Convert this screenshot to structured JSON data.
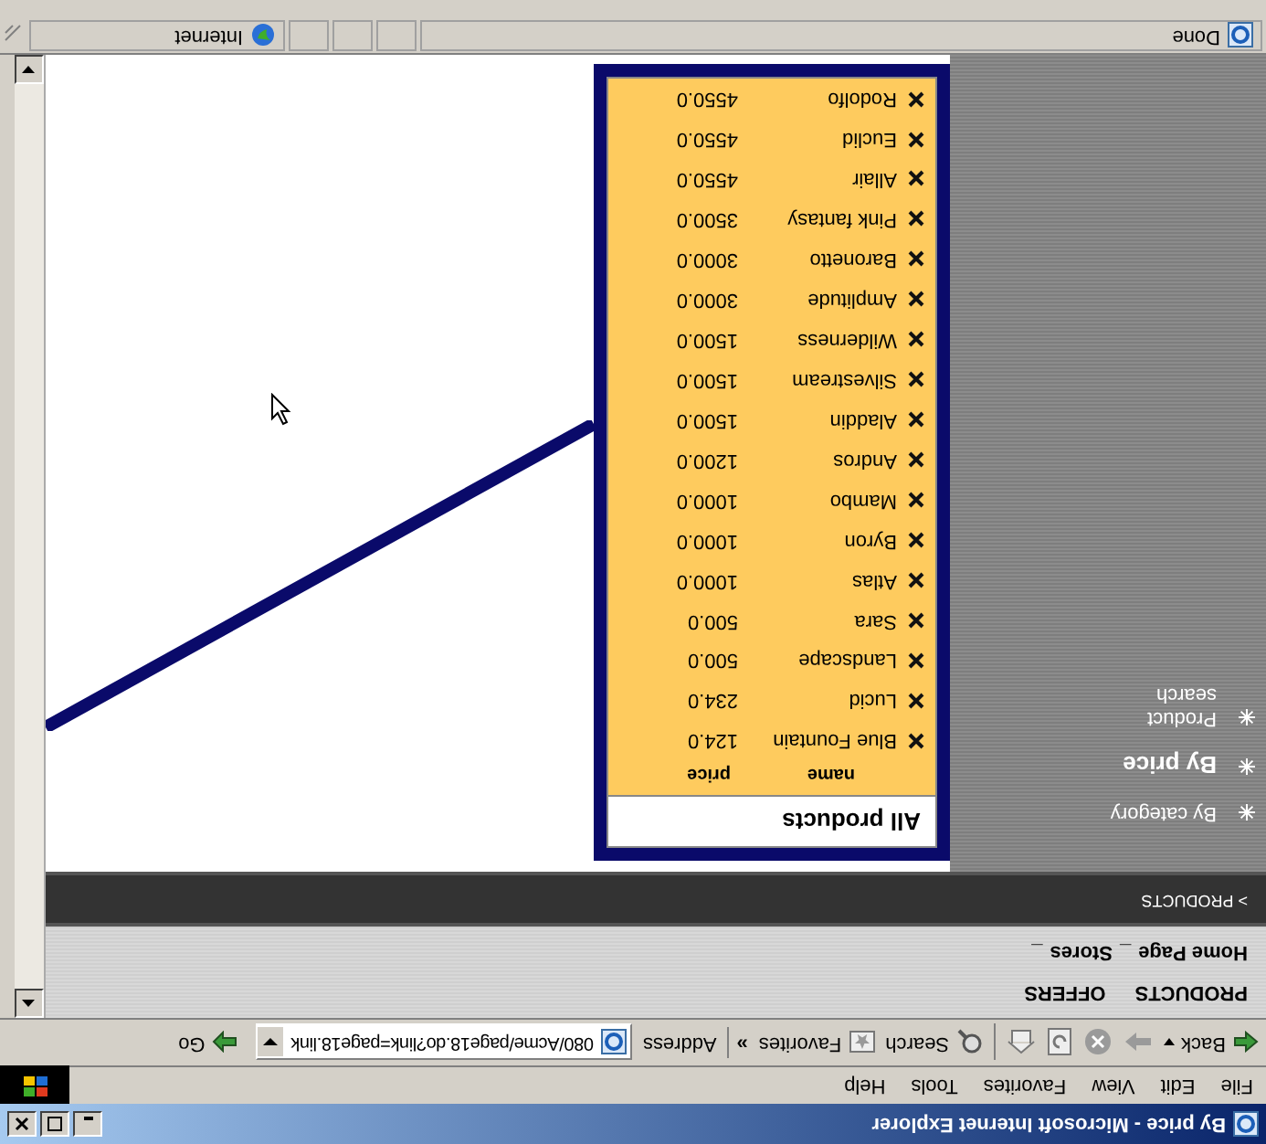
{
  "window": {
    "title": "By price - Microsoft Internet Explorer"
  },
  "menu": [
    "File",
    "Edit",
    "View",
    "Favorites",
    "Tools",
    "Help"
  ],
  "toolbar": {
    "back": "Back",
    "search": "Search",
    "favorites": "Favorites",
    "more": "»",
    "address_label": "Address",
    "address": "080/Acme/page18.do?link=page18.link",
    "go": "Go"
  },
  "nav": {
    "top_links": [
      "PRODUCTS",
      "OFFERS"
    ],
    "sub_links": [
      "Home Page",
      "_",
      "Stores",
      "_"
    ],
    "breadcrumb": "> PRODUCTS"
  },
  "sidebar": [
    {
      "label": "By category",
      "selected": false
    },
    {
      "label": "By price",
      "selected": true
    },
    {
      "label": "Product search",
      "selected": false
    }
  ],
  "panel": {
    "title": "All products",
    "columns": [
      "name",
      "price"
    ],
    "rows": [
      {
        "name": "Blue Fountain",
        "price": "124.0"
      },
      {
        "name": "Lucid",
        "price": "234.0"
      },
      {
        "name": "Landscape",
        "price": "500.0"
      },
      {
        "name": "Sara",
        "price": "500.0"
      },
      {
        "name": "Atlas",
        "price": "1000.0"
      },
      {
        "name": "Byron",
        "price": "1000.0"
      },
      {
        "name": "Mambo",
        "price": "1000.0"
      },
      {
        "name": "Andros",
        "price": "1200.0"
      },
      {
        "name": "Aladdin",
        "price": "1500.0"
      },
      {
        "name": "Silvestream",
        "price": "1500.0"
      },
      {
        "name": "Wilderness",
        "price": "1500.0"
      },
      {
        "name": "Amplitude",
        "price": "3000.0"
      },
      {
        "name": "Baronetto",
        "price": "3000.0"
      },
      {
        "name": "Pink fantasy",
        "price": "3500.0"
      },
      {
        "name": "Allair",
        "price": "4550.0"
      },
      {
        "name": "Euclid",
        "price": "4550.0"
      },
      {
        "name": "Rodolfo",
        "price": "4550.0"
      }
    ]
  },
  "status_bar": {
    "status": "Done",
    "zone": "Internet"
  }
}
